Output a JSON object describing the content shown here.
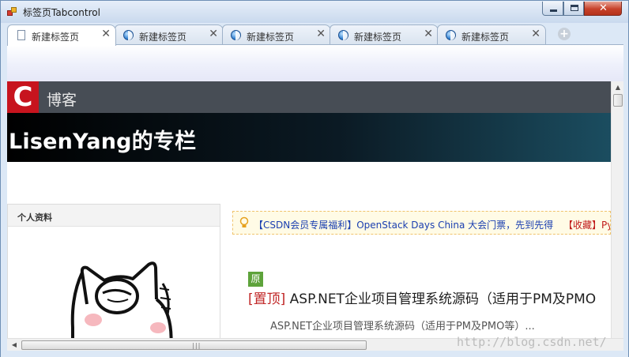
{
  "window": {
    "title": "标签页Tabcontrol",
    "close_glyph": "✕",
    "min_glyph": "",
    "max_glyph": ""
  },
  "tabs": [
    {
      "label": "新建标签页",
      "icon": "document-icon",
      "active": true
    },
    {
      "label": "新建标签页",
      "icon": "loading-globe-icon",
      "active": false
    },
    {
      "label": "新建标签页",
      "icon": "loading-globe-icon",
      "active": false
    },
    {
      "label": "新建标签页",
      "icon": "loading-globe-icon",
      "active": false
    },
    {
      "label": "新建标签页",
      "icon": "loading-globe-icon",
      "active": false
    }
  ],
  "tab_close_glyph": "✕",
  "new_tab_glyph": "+",
  "page": {
    "brand_logo_letter": "C",
    "brand_section": "博客",
    "blog_title": "LisenYang的专栏",
    "sidebar_title": "个人资料",
    "notice_main": "【CSDN会员专属福利】OpenStack Days China 大会门票，先到先得",
    "notice_extra": "【收藏】Pyt",
    "article_badge": "原",
    "article_pin": "[置顶]",
    "article_title": " ASP.NET企业项目管理系统源码（适用于PM及PMO",
    "article_summary": "ASP.NET企业项目管理系统源码（适用于PM及PMO等）..."
  },
  "scroll": {
    "up_arrow": "▲",
    "left_arrow": "◀",
    "grip": "|||"
  },
  "watermark": "http://blog.csdn.net/",
  "colors": {
    "csdn_red": "#c7141e",
    "brand_bar": "#474d55",
    "notice_link": "#1a3fb0",
    "pin_red": "#c02626",
    "original_green": "#5ea33b"
  }
}
